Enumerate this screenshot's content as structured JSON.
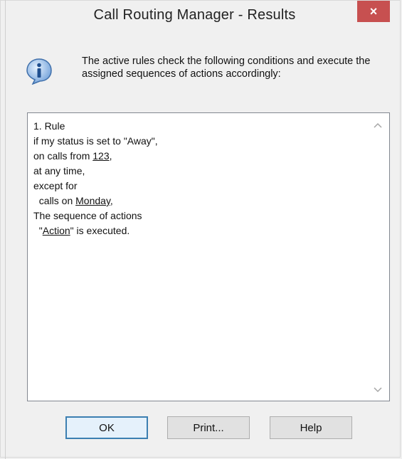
{
  "window": {
    "title": "Call Routing Manager - Results",
    "close_label": "×"
  },
  "intro": {
    "text": "The active rules check the following conditions and execute the assigned sequences of actions accordingly:"
  },
  "rules": {
    "lines": [
      "1. Rule",
      "if my status is set to \"Away\",",
      "on calls from ",
      "at any time,",
      "except for",
      "  calls on ",
      "The sequence of actions",
      "  \"",
      " is executed."
    ],
    "from_number": "123",
    "day": "Monday",
    "action_name": "Action"
  },
  "buttons": {
    "ok": "OK",
    "print": "Print...",
    "help": "Help"
  },
  "colors": {
    "close": "#c75050",
    "accent": "#3c7fb1"
  },
  "icons": {
    "info": "info-icon",
    "scroll_up": "chevron-up-icon",
    "scroll_down": "chevron-down-icon"
  }
}
